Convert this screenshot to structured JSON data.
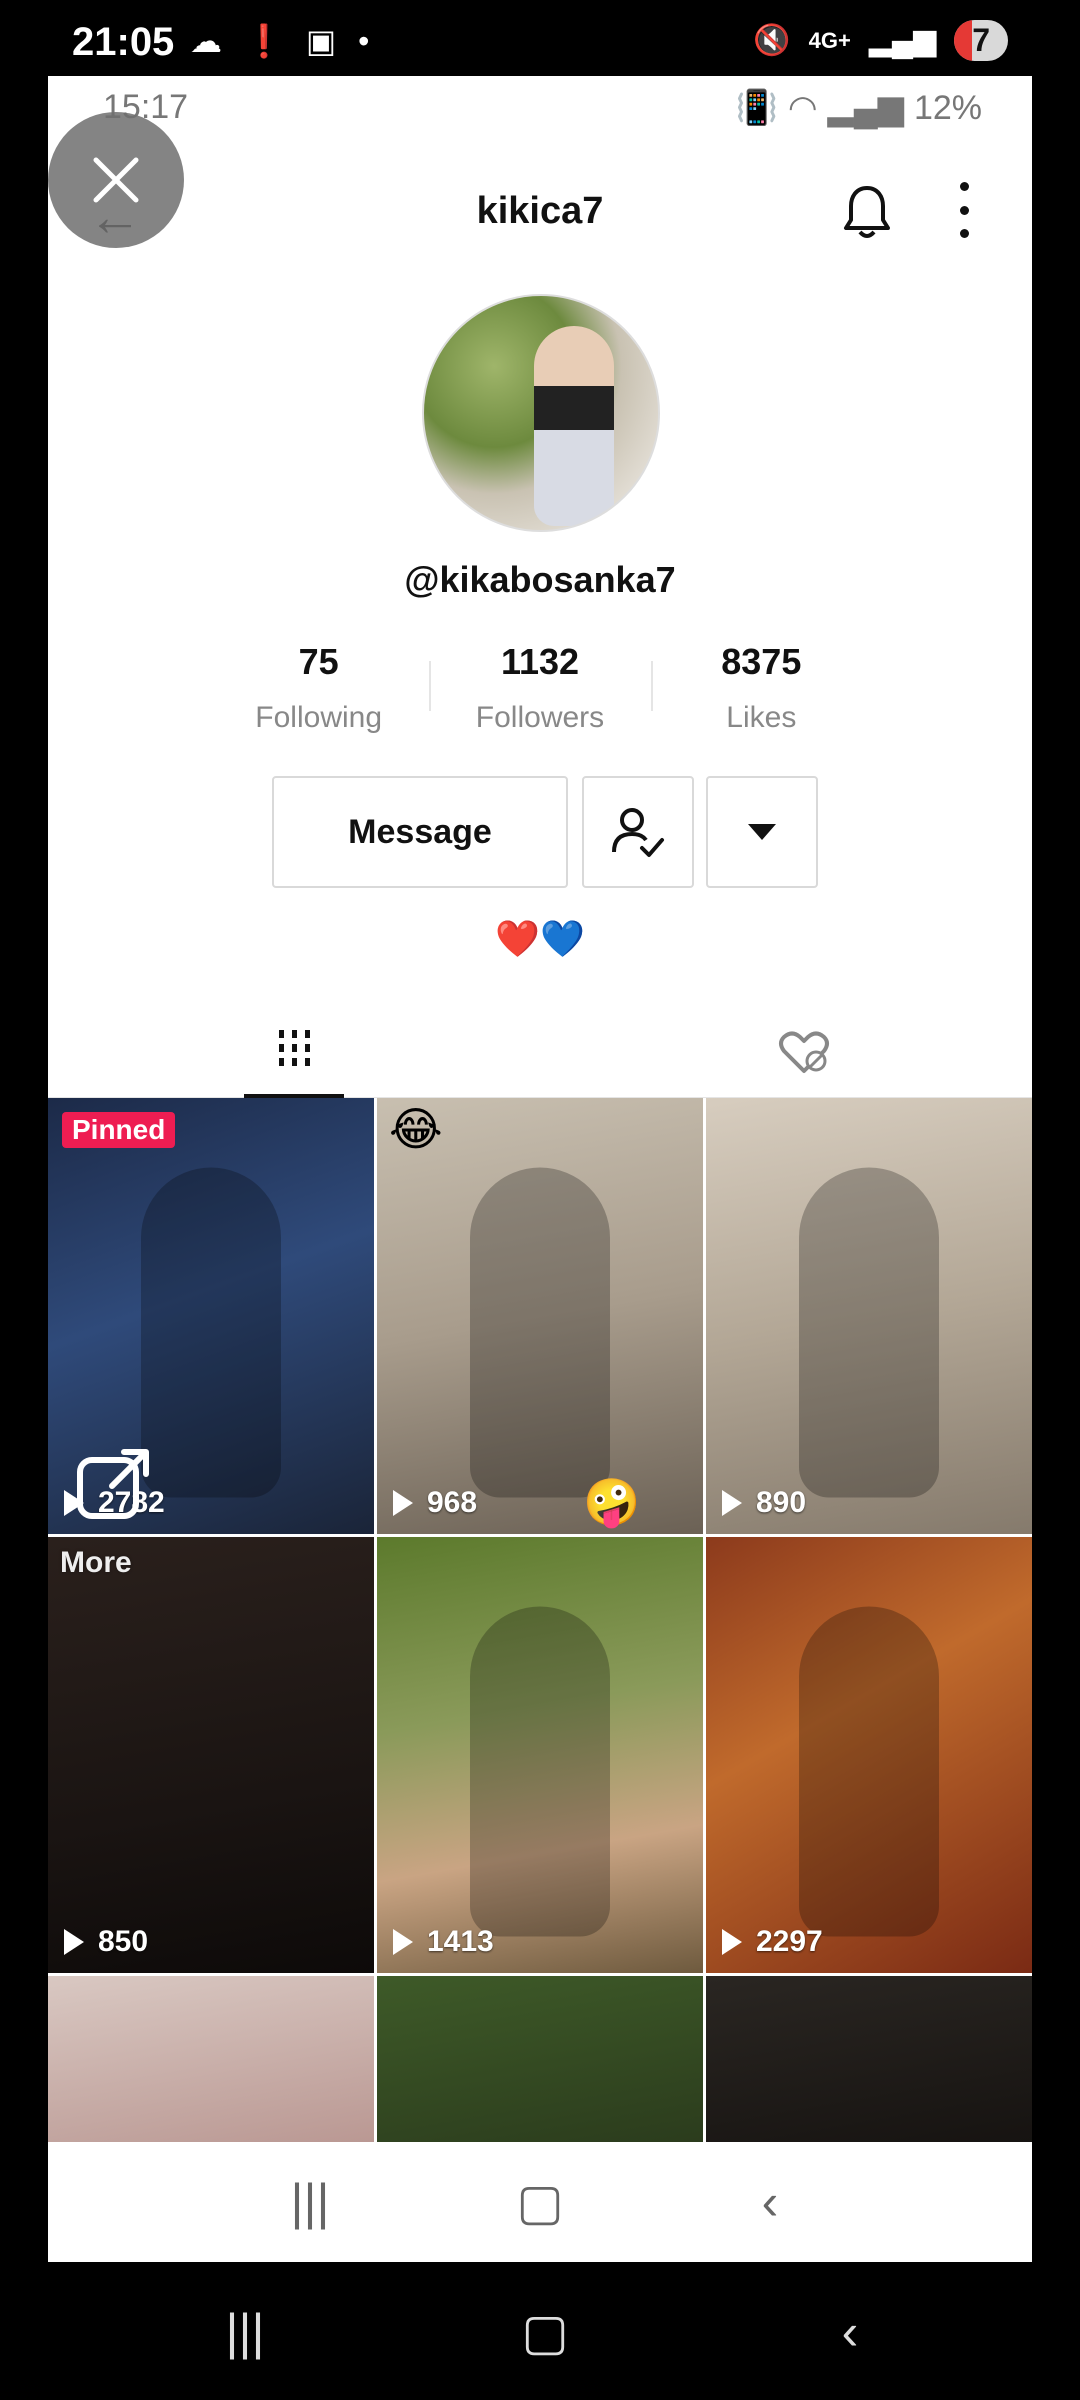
{
  "device_status": {
    "time": "21:05",
    "network": "4G+",
    "battery_level": "7"
  },
  "screenshot_status": {
    "time": "15:17",
    "battery_percent": "12%"
  },
  "profile": {
    "username": "kikica7",
    "handle": "@kikabosanka7",
    "bio_emojis": [
      "❤️",
      "💙"
    ],
    "stats": [
      {
        "value": "75",
        "label": "Following"
      },
      {
        "value": "1132",
        "label": "Followers"
      },
      {
        "value": "8375",
        "label": "Likes"
      }
    ]
  },
  "actions": {
    "message_label": "Message"
  },
  "tabs": [
    {
      "icon": "grid-icon",
      "selected": true
    },
    {
      "icon": "liked-hidden-icon",
      "selected": false
    }
  ],
  "videos": [
    {
      "views": "2782",
      "pinned_label": "Pinned"
    },
    {
      "views": "968",
      "top_emoji": "😂",
      "corner_emoji": "🤪"
    },
    {
      "views": "890"
    },
    {
      "views": "850"
    },
    {
      "views": "1413"
    },
    {
      "views": "2297"
    }
  ],
  "overlay": {
    "more_label": "More"
  }
}
